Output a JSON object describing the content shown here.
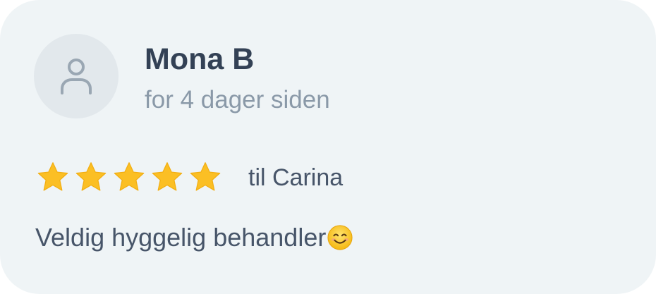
{
  "review": {
    "reviewer_name": "Mona B",
    "timestamp": "for 4 dager siden",
    "rating": 5,
    "rating_max": 5,
    "staff_label": "til Carina",
    "text": "Veldig hyggelig behandler",
    "emoji": "smiling-face-emoji"
  },
  "icons": {
    "avatar": "user-icon",
    "star": "star-icon"
  },
  "colors": {
    "card_background": "#eff4f6",
    "avatar_background": "#e2e8ec",
    "star": "#fbbf24",
    "name": "#334155",
    "muted": "#8a99a8",
    "body": "#475569"
  }
}
